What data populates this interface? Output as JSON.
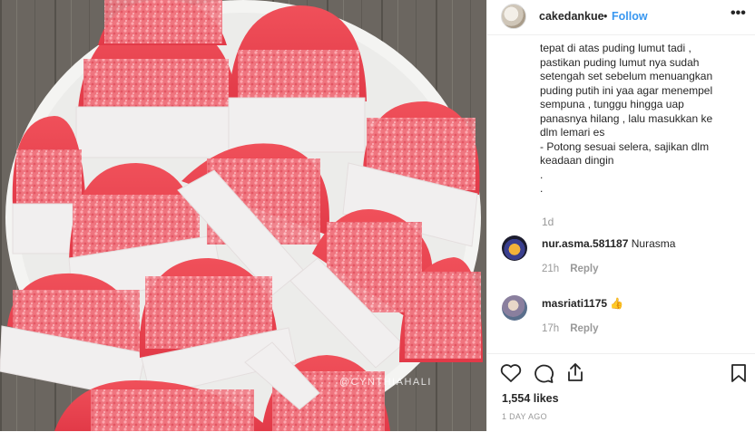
{
  "post": {
    "watermark": "@CYNTHIAHALI",
    "author": {
      "username": "cakedankue",
      "follow_label": "Follow",
      "dot": "•",
      "more_label": "•••"
    },
    "caption_lines": [
      "tepat di atas puding lumut tadi ,",
      "pastikan puding lumut nya sudah",
      "setengah set sebelum menuangkan",
      "puding putih ini yaa agar menempel",
      "sempuna , tunggu hingga uap",
      "panasnya hilang , lalu masukkan ke",
      "dlm lemari es",
      "- Potong sesuai selera, sajikan dlm",
      "keadaan dingin",
      ".",
      "."
    ],
    "caption_time": "1d",
    "comments": [
      {
        "username": "nur.asma.581187",
        "text": "Nurasma",
        "time": "21h",
        "reply_label": "Reply"
      },
      {
        "username": "masriati1175",
        "text": "👍",
        "time": "17h",
        "reply_label": "Reply"
      }
    ],
    "likes_label": "1,554 likes",
    "date_label": "1 DAY AGO",
    "icons": [
      "heart-icon",
      "comment-icon",
      "share-icon",
      "bookmark-icon"
    ]
  }
}
